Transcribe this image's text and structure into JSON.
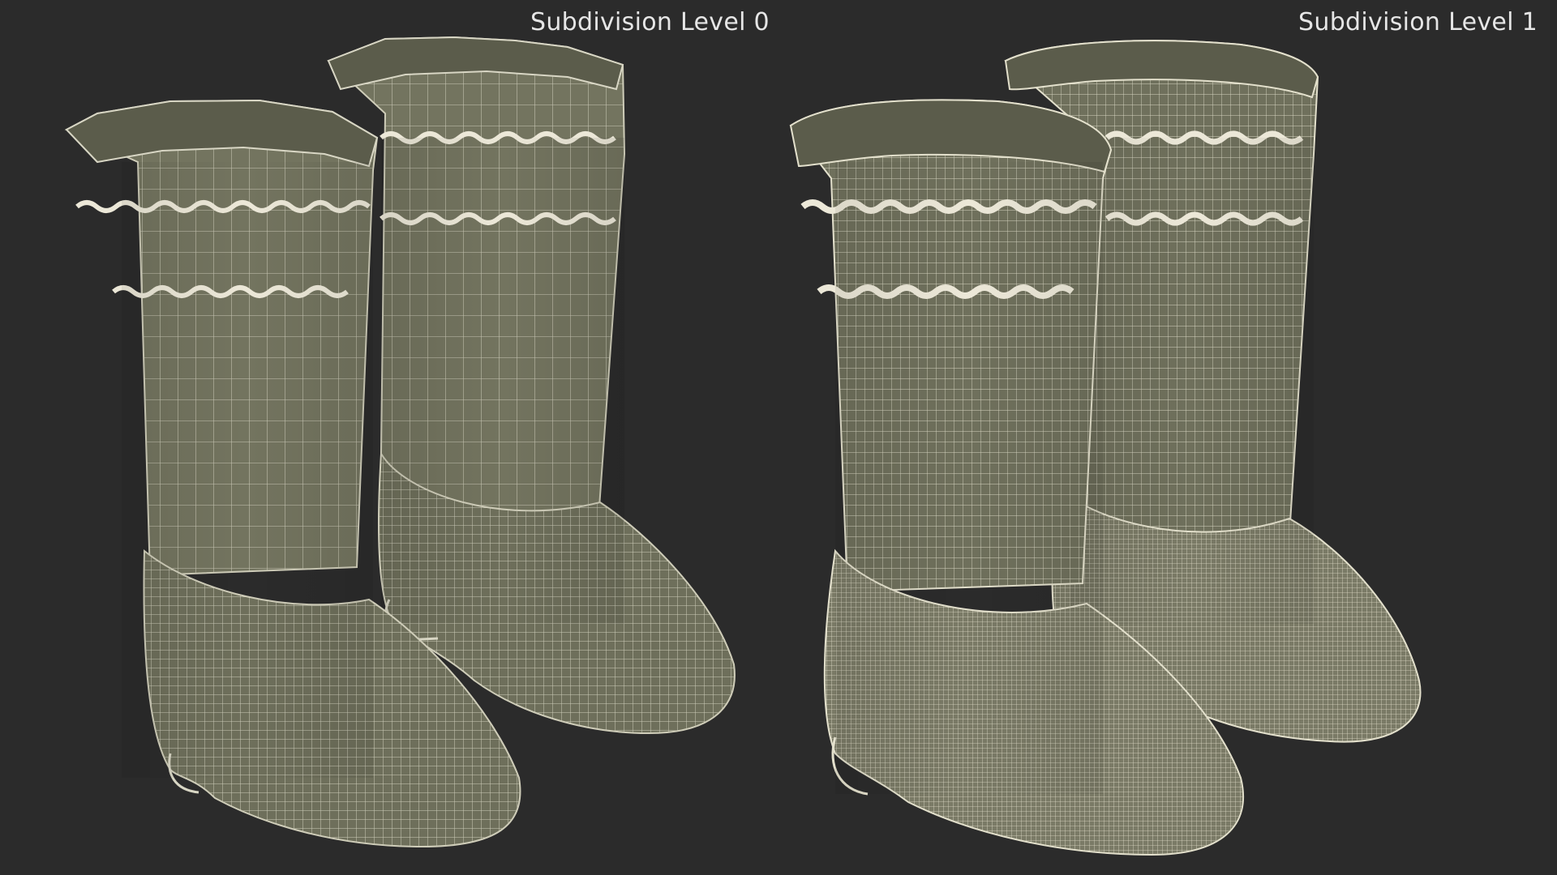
{
  "viewer": {
    "background_color": "#2b2b2b",
    "panels": [
      {
        "label": "Subdivision Level 0",
        "wire_density": "low"
      },
      {
        "label": "Subdivision Level 1",
        "wire_density": "high"
      }
    ]
  },
  "colors": {
    "mesh_fill": "#73745f",
    "mesh_fill_dark": "#5e5f4e",
    "wire_low": "#d8d6c4",
    "wire_high": "#e3e0cc",
    "trim": "#ece8d8"
  }
}
